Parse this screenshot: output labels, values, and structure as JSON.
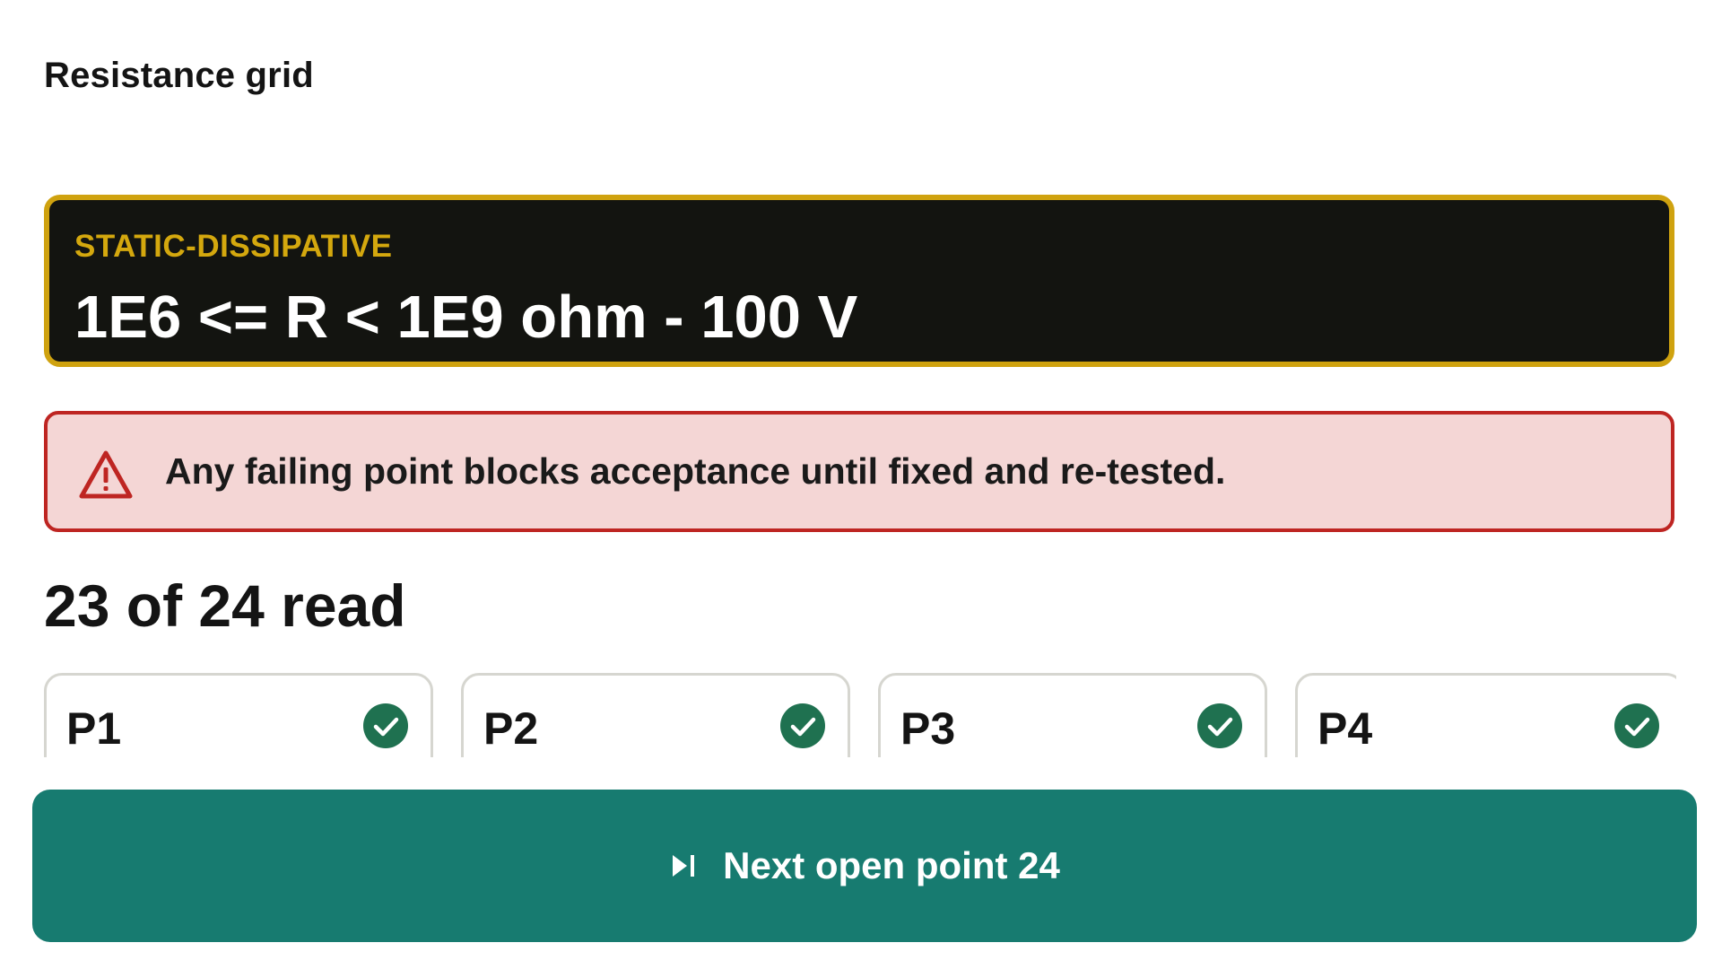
{
  "page": {
    "title": "Resistance grid"
  },
  "spec": {
    "category": "STATIC-DISSIPATIVE",
    "range": "1E6 <= R < 1E9 ohm - 100 V"
  },
  "warning": {
    "icon": "warning-triangle-icon",
    "text": "Any failing point blocks acceptance until fixed and re-tested."
  },
  "progress": {
    "read": 23,
    "total": 24,
    "label": "23 of 24 read"
  },
  "points": [
    {
      "label": "P1",
      "status": "pass",
      "icon": "check-circle-icon"
    },
    {
      "label": "P2",
      "status": "pass",
      "icon": "check-circle-icon"
    },
    {
      "label": "P3",
      "status": "pass",
      "icon": "check-circle-icon"
    },
    {
      "label": "P4",
      "status": "pass",
      "icon": "check-circle-icon"
    }
  ],
  "next_button": {
    "icon": "skip-next-icon",
    "label": "Next open point 24"
  },
  "colors": {
    "spec_border": "#cfa20f",
    "spec_background": "#131410",
    "warning_border": "#be2522",
    "warning_background": "#f4d6d5",
    "pass": "#1f7150",
    "primary_button": "#177b70"
  }
}
